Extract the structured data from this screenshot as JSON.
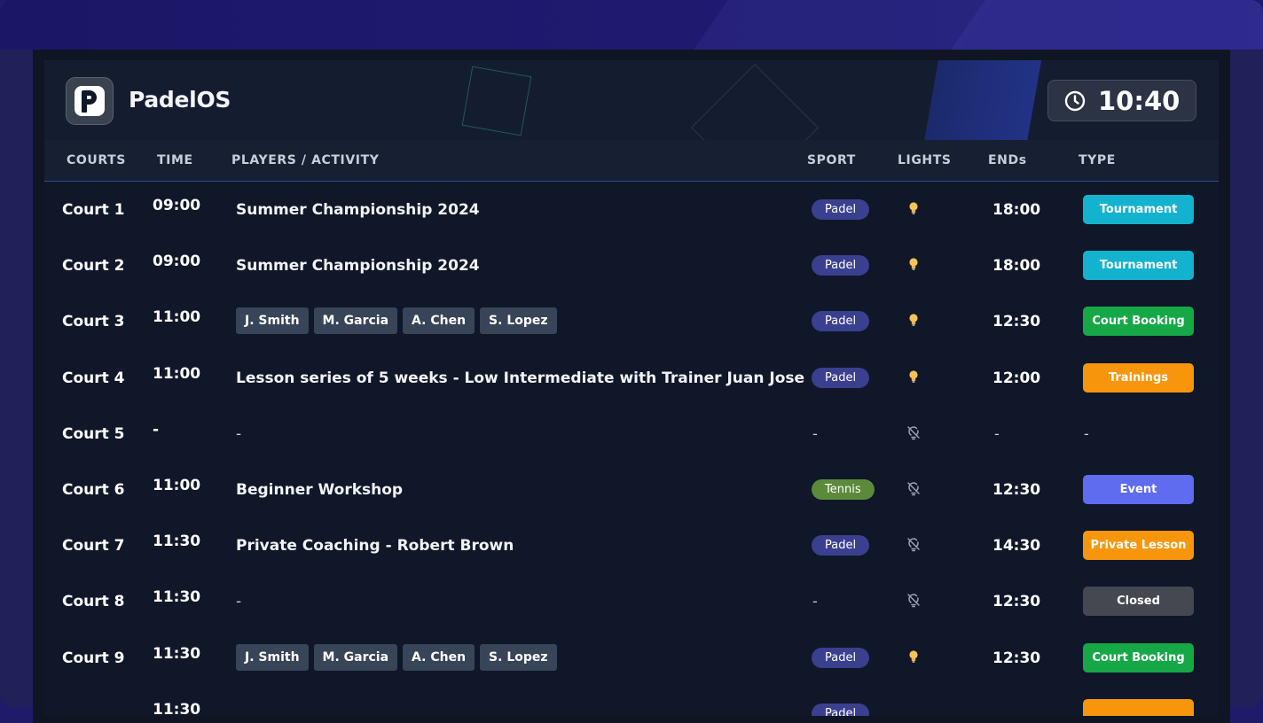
{
  "app": {
    "name": "PadelOS",
    "logo_letter": "P"
  },
  "clock": {
    "time": "10:40",
    "icon": "clock-icon"
  },
  "columns": [
    "COURTS",
    "TIME",
    "PLAYERS / ACTIVITY",
    "SPORT",
    "LIGHTS",
    "ENDs",
    "TYPE"
  ],
  "colors": {
    "tournament": "#13b3cf",
    "court_booking": "#16a847",
    "trainings": "#f7950d",
    "event": "#5f6cf0",
    "private_lesson": "#f7950d",
    "closed": "#454850",
    "light_on": "#f4c35a",
    "light_off": "#9aa3b2"
  },
  "rows": [
    {
      "court": "Court 1",
      "time": "09:00",
      "activity": "Summer Championship 2024",
      "players": [],
      "sport": "Padel",
      "lights": "on",
      "ends": "18:00",
      "type": "Tournament",
      "type_key": "tournament"
    },
    {
      "court": "Court 2",
      "time": "09:00",
      "activity": "Summer Championship 2024",
      "players": [],
      "sport": "Padel",
      "lights": "on",
      "ends": "18:00",
      "type": "Tournament",
      "type_key": "tournament"
    },
    {
      "court": "Court 3",
      "time": "11:00",
      "activity": "",
      "players": [
        "J. Smith",
        "M. Garcia",
        "A. Chen",
        "S. Lopez"
      ],
      "sport": "Padel",
      "lights": "on",
      "ends": "12:30",
      "type": "Court Booking",
      "type_key": "court_booking"
    },
    {
      "court": "Court 4",
      "time": "11:00",
      "activity": "Lesson series of 5 weeks - Low Intermediate with Trainer Juan Jose",
      "players": [],
      "sport": "Padel",
      "lights": "on",
      "ends": "12:00",
      "type": "Trainings",
      "type_key": "trainings"
    },
    {
      "court": "Court 5",
      "time": "-",
      "activity": "-",
      "players": [],
      "sport": "-",
      "lights": "off",
      "ends": "-",
      "type": "-",
      "type_key": ""
    },
    {
      "court": "Court 6",
      "time": "11:00",
      "activity": "Beginner Workshop",
      "players": [],
      "sport": "Tennis",
      "lights": "off",
      "ends": "12:30",
      "type": "Event",
      "type_key": "event"
    },
    {
      "court": "Court 7",
      "time": "11:30",
      "activity": "Private Coaching - Robert Brown",
      "players": [],
      "sport": "Padel",
      "lights": "off",
      "ends": "14:30",
      "type": "Private Lesson",
      "type_key": "private_lesson"
    },
    {
      "court": "Court 8",
      "time": "11:30",
      "activity": "-",
      "players": [],
      "sport": "-",
      "lights": "off",
      "ends": "12:30",
      "type": "Closed",
      "type_key": "closed"
    },
    {
      "court": "Court 9",
      "time": "11:30",
      "activity": "",
      "players": [
        "J. Smith",
        "M. Garcia",
        "A. Chen",
        "S. Lopez"
      ],
      "sport": "Padel",
      "lights": "on",
      "ends": "12:30",
      "type": "Court Booking",
      "type_key": "court_booking"
    },
    {
      "court": "",
      "time": "11:30",
      "activity": "",
      "players": [],
      "sport": "Padel",
      "lights": "",
      "ends": "",
      "type": "",
      "type_key": "trainings"
    }
  ]
}
